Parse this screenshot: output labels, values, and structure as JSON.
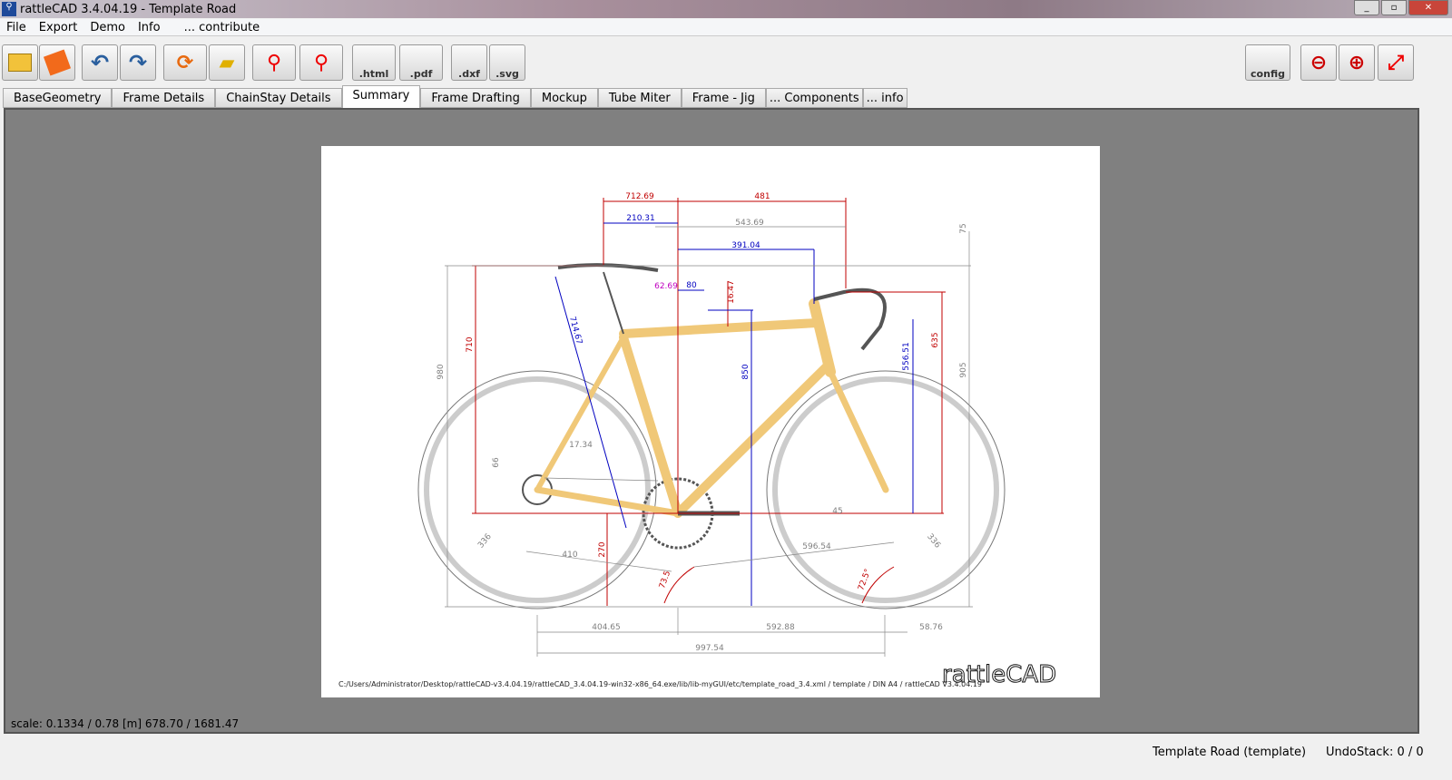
{
  "window": {
    "title": "rattleCAD  3.4.04.19 - Template Road"
  },
  "menu": [
    "File",
    "Export",
    "Demo",
    "Info",
    "... contribute"
  ],
  "toolbar": {
    "open": "open-folder",
    "save": "save",
    "undo": "undo",
    "redo": "redo",
    "update": "update-bike",
    "erase": "eraser",
    "bike1": "bike-red",
    "bike2": "bike-red-alt",
    "html": ".html",
    "pdf": ".pdf",
    "dxf": ".dxf",
    "svg": ".svg",
    "config": "config",
    "zoom_out": "zoom-out",
    "zoom_in": "zoom-in",
    "fit": "fit"
  },
  "tabs": [
    {
      "label": "BaseGeometry"
    },
    {
      "label": "Frame Details"
    },
    {
      "label": "ChainStay Details"
    },
    {
      "label": "Summary",
      "active": true
    },
    {
      "label": "Frame Drafting"
    },
    {
      "label": "Mockup"
    },
    {
      "label": "Tube Miter"
    },
    {
      "label": "Frame - Jig"
    },
    {
      "label": "... Components"
    },
    {
      "label": "... info"
    }
  ],
  "drawing": {
    "dims": {
      "d71269": "712.69",
      "d481": "481",
      "d21031": "210.31",
      "d54369": "543.69",
      "d39104": "391.04",
      "d75": "75",
      "d6269": "62.69",
      "d80": "80",
      "d1647": "16.47",
      "d710": "710",
      "d980": "980",
      "d71467": "714.67",
      "d850": "850",
      "d55651": "556.51",
      "d635": "635",
      "d905": "905",
      "d1734": "17.34",
      "d66": "66",
      "d336a": "336",
      "d336b": "336",
      "d410": "410",
      "d270": "270",
      "d45": "45",
      "d59654": "596.54",
      "d735": "73.5",
      "d725": "72.5°",
      "d40465": "404.65",
      "d59788": "592.88",
      "d5876": "58.76",
      "d99754": "997.54"
    },
    "footer": "C:/Users/Administrator/Desktop/rattleCAD-v3.4.04.19/rattleCAD_3.4.04.19-win32-x86_64.exe/lib/lib-myGUI/etc/template_road_3.4.xml   /   template   /  DIN A4  /   rattleCAD   V3.4.04.19",
    "logo": "rattleCAD",
    "colors": {
      "frame": "#f0c878",
      "red_dim": "#c00000",
      "blue_dim": "#0000c0",
      "magenta_dim": "#c000c0",
      "grey_dim": "#808080"
    }
  },
  "status": {
    "scale": "scale: 0.1334 / 0.78  [m]  678.70 / 1681.47",
    "template": "Template Road (template)",
    "undo": "UndoStack:  0 /  0"
  }
}
